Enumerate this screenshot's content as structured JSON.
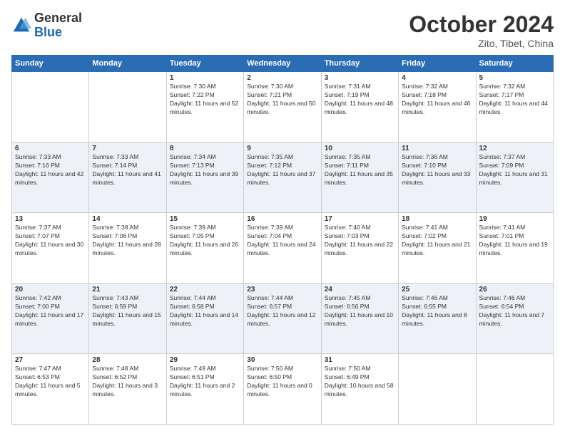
{
  "header": {
    "logo_general": "General",
    "logo_blue": "Blue",
    "month_year": "October 2024",
    "location": "Zito, Tibet, China"
  },
  "days_of_week": [
    "Sunday",
    "Monday",
    "Tuesday",
    "Wednesday",
    "Thursday",
    "Friday",
    "Saturday"
  ],
  "weeks": [
    [
      {
        "day": "",
        "sunrise": "",
        "sunset": "",
        "daylight": "",
        "empty": true
      },
      {
        "day": "",
        "sunrise": "",
        "sunset": "",
        "daylight": "",
        "empty": true
      },
      {
        "day": "1",
        "sunrise": "Sunrise: 7:30 AM",
        "sunset": "Sunset: 7:22 PM",
        "daylight": "Daylight: 11 hours and 52 minutes.",
        "empty": false
      },
      {
        "day": "2",
        "sunrise": "Sunrise: 7:30 AM",
        "sunset": "Sunset: 7:21 PM",
        "daylight": "Daylight: 11 hours and 50 minutes.",
        "empty": false
      },
      {
        "day": "3",
        "sunrise": "Sunrise: 7:31 AM",
        "sunset": "Sunset: 7:19 PM",
        "daylight": "Daylight: 11 hours and 48 minutes.",
        "empty": false
      },
      {
        "day": "4",
        "sunrise": "Sunrise: 7:32 AM",
        "sunset": "Sunset: 7:18 PM",
        "daylight": "Daylight: 11 hours and 46 minutes.",
        "empty": false
      },
      {
        "day": "5",
        "sunrise": "Sunrise: 7:32 AM",
        "sunset": "Sunset: 7:17 PM",
        "daylight": "Daylight: 11 hours and 44 minutes.",
        "empty": false
      }
    ],
    [
      {
        "day": "6",
        "sunrise": "Sunrise: 7:33 AM",
        "sunset": "Sunset: 7:16 PM",
        "daylight": "Daylight: 11 hours and 42 minutes.",
        "empty": false
      },
      {
        "day": "7",
        "sunrise": "Sunrise: 7:33 AM",
        "sunset": "Sunset: 7:14 PM",
        "daylight": "Daylight: 11 hours and 41 minutes.",
        "empty": false
      },
      {
        "day": "8",
        "sunrise": "Sunrise: 7:34 AM",
        "sunset": "Sunset: 7:13 PM",
        "daylight": "Daylight: 11 hours and 39 minutes.",
        "empty": false
      },
      {
        "day": "9",
        "sunrise": "Sunrise: 7:35 AM",
        "sunset": "Sunset: 7:12 PM",
        "daylight": "Daylight: 11 hours and 37 minutes.",
        "empty": false
      },
      {
        "day": "10",
        "sunrise": "Sunrise: 7:35 AM",
        "sunset": "Sunset: 7:11 PM",
        "daylight": "Daylight: 11 hours and 35 minutes.",
        "empty": false
      },
      {
        "day": "11",
        "sunrise": "Sunrise: 7:36 AM",
        "sunset": "Sunset: 7:10 PM",
        "daylight": "Daylight: 11 hours and 33 minutes.",
        "empty": false
      },
      {
        "day": "12",
        "sunrise": "Sunrise: 7:37 AM",
        "sunset": "Sunset: 7:09 PM",
        "daylight": "Daylight: 11 hours and 31 minutes.",
        "empty": false
      }
    ],
    [
      {
        "day": "13",
        "sunrise": "Sunrise: 7:37 AM",
        "sunset": "Sunset: 7:07 PM",
        "daylight": "Daylight: 11 hours and 30 minutes.",
        "empty": false
      },
      {
        "day": "14",
        "sunrise": "Sunrise: 7:38 AM",
        "sunset": "Sunset: 7:06 PM",
        "daylight": "Daylight: 11 hours and 28 minutes.",
        "empty": false
      },
      {
        "day": "15",
        "sunrise": "Sunrise: 7:39 AM",
        "sunset": "Sunset: 7:05 PM",
        "daylight": "Daylight: 11 hours and 26 minutes.",
        "empty": false
      },
      {
        "day": "16",
        "sunrise": "Sunrise: 7:39 AM",
        "sunset": "Sunset: 7:04 PM",
        "daylight": "Daylight: 11 hours and 24 minutes.",
        "empty": false
      },
      {
        "day": "17",
        "sunrise": "Sunrise: 7:40 AM",
        "sunset": "Sunset: 7:03 PM",
        "daylight": "Daylight: 11 hours and 22 minutes.",
        "empty": false
      },
      {
        "day": "18",
        "sunrise": "Sunrise: 7:41 AM",
        "sunset": "Sunset: 7:02 PM",
        "daylight": "Daylight: 11 hours and 21 minutes.",
        "empty": false
      },
      {
        "day": "19",
        "sunrise": "Sunrise: 7:41 AM",
        "sunset": "Sunset: 7:01 PM",
        "daylight": "Daylight: 11 hours and 19 minutes.",
        "empty": false
      }
    ],
    [
      {
        "day": "20",
        "sunrise": "Sunrise: 7:42 AM",
        "sunset": "Sunset: 7:00 PM",
        "daylight": "Daylight: 11 hours and 17 minutes.",
        "empty": false
      },
      {
        "day": "21",
        "sunrise": "Sunrise: 7:43 AM",
        "sunset": "Sunset: 6:59 PM",
        "daylight": "Daylight: 11 hours and 15 minutes.",
        "empty": false
      },
      {
        "day": "22",
        "sunrise": "Sunrise: 7:44 AM",
        "sunset": "Sunset: 6:58 PM",
        "daylight": "Daylight: 11 hours and 14 minutes.",
        "empty": false
      },
      {
        "day": "23",
        "sunrise": "Sunrise: 7:44 AM",
        "sunset": "Sunset: 6:57 PM",
        "daylight": "Daylight: 11 hours and 12 minutes.",
        "empty": false
      },
      {
        "day": "24",
        "sunrise": "Sunrise: 7:45 AM",
        "sunset": "Sunset: 6:56 PM",
        "daylight": "Daylight: 11 hours and 10 minutes.",
        "empty": false
      },
      {
        "day": "25",
        "sunrise": "Sunrise: 7:46 AM",
        "sunset": "Sunset: 6:55 PM",
        "daylight": "Daylight: 11 hours and 8 minutes.",
        "empty": false
      },
      {
        "day": "26",
        "sunrise": "Sunrise: 7:46 AM",
        "sunset": "Sunset: 6:54 PM",
        "daylight": "Daylight: 11 hours and 7 minutes.",
        "empty": false
      }
    ],
    [
      {
        "day": "27",
        "sunrise": "Sunrise: 7:47 AM",
        "sunset": "Sunset: 6:53 PM",
        "daylight": "Daylight: 11 hours and 5 minutes.",
        "empty": false
      },
      {
        "day": "28",
        "sunrise": "Sunrise: 7:48 AM",
        "sunset": "Sunset: 6:52 PM",
        "daylight": "Daylight: 11 hours and 3 minutes.",
        "empty": false
      },
      {
        "day": "29",
        "sunrise": "Sunrise: 7:49 AM",
        "sunset": "Sunset: 6:51 PM",
        "daylight": "Daylight: 11 hours and 2 minutes.",
        "empty": false
      },
      {
        "day": "30",
        "sunrise": "Sunrise: 7:50 AM",
        "sunset": "Sunset: 6:50 PM",
        "daylight": "Daylight: 11 hours and 0 minutes.",
        "empty": false
      },
      {
        "day": "31",
        "sunrise": "Sunrise: 7:50 AM",
        "sunset": "Sunset: 6:49 PM",
        "daylight": "Daylight: 10 hours and 58 minutes.",
        "empty": false
      },
      {
        "day": "",
        "sunrise": "",
        "sunset": "",
        "daylight": "",
        "empty": true
      },
      {
        "day": "",
        "sunrise": "",
        "sunset": "",
        "daylight": "",
        "empty": true
      }
    ]
  ]
}
